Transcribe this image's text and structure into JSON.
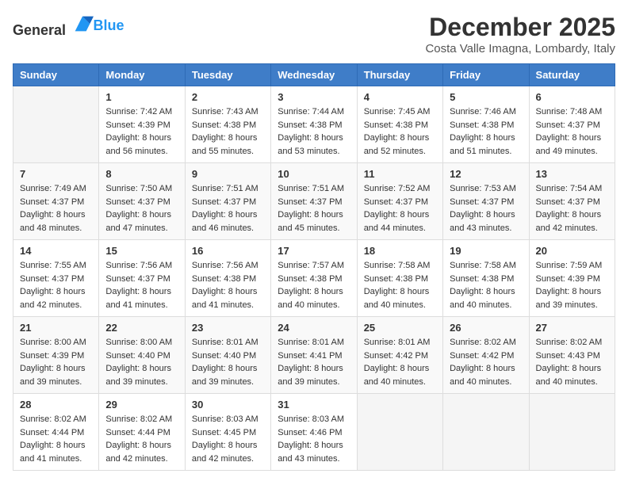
{
  "header": {
    "logo_general": "General",
    "logo_blue": "Blue",
    "month": "December 2025",
    "location": "Costa Valle Imagna, Lombardy, Italy"
  },
  "weekdays": [
    "Sunday",
    "Monday",
    "Tuesday",
    "Wednesday",
    "Thursday",
    "Friday",
    "Saturday"
  ],
  "weeks": [
    [
      {
        "day": "",
        "sunrise": "",
        "sunset": "",
        "daylight": ""
      },
      {
        "day": "1",
        "sunrise": "Sunrise: 7:42 AM",
        "sunset": "Sunset: 4:39 PM",
        "daylight": "Daylight: 8 hours and 56 minutes."
      },
      {
        "day": "2",
        "sunrise": "Sunrise: 7:43 AM",
        "sunset": "Sunset: 4:38 PM",
        "daylight": "Daylight: 8 hours and 55 minutes."
      },
      {
        "day": "3",
        "sunrise": "Sunrise: 7:44 AM",
        "sunset": "Sunset: 4:38 PM",
        "daylight": "Daylight: 8 hours and 53 minutes."
      },
      {
        "day": "4",
        "sunrise": "Sunrise: 7:45 AM",
        "sunset": "Sunset: 4:38 PM",
        "daylight": "Daylight: 8 hours and 52 minutes."
      },
      {
        "day": "5",
        "sunrise": "Sunrise: 7:46 AM",
        "sunset": "Sunset: 4:38 PM",
        "daylight": "Daylight: 8 hours and 51 minutes."
      },
      {
        "day": "6",
        "sunrise": "Sunrise: 7:48 AM",
        "sunset": "Sunset: 4:37 PM",
        "daylight": "Daylight: 8 hours and 49 minutes."
      }
    ],
    [
      {
        "day": "7",
        "sunrise": "Sunrise: 7:49 AM",
        "sunset": "Sunset: 4:37 PM",
        "daylight": "Daylight: 8 hours and 48 minutes."
      },
      {
        "day": "8",
        "sunrise": "Sunrise: 7:50 AM",
        "sunset": "Sunset: 4:37 PM",
        "daylight": "Daylight: 8 hours and 47 minutes."
      },
      {
        "day": "9",
        "sunrise": "Sunrise: 7:51 AM",
        "sunset": "Sunset: 4:37 PM",
        "daylight": "Daylight: 8 hours and 46 minutes."
      },
      {
        "day": "10",
        "sunrise": "Sunrise: 7:51 AM",
        "sunset": "Sunset: 4:37 PM",
        "daylight": "Daylight: 8 hours and 45 minutes."
      },
      {
        "day": "11",
        "sunrise": "Sunrise: 7:52 AM",
        "sunset": "Sunset: 4:37 PM",
        "daylight": "Daylight: 8 hours and 44 minutes."
      },
      {
        "day": "12",
        "sunrise": "Sunrise: 7:53 AM",
        "sunset": "Sunset: 4:37 PM",
        "daylight": "Daylight: 8 hours and 43 minutes."
      },
      {
        "day": "13",
        "sunrise": "Sunrise: 7:54 AM",
        "sunset": "Sunset: 4:37 PM",
        "daylight": "Daylight: 8 hours and 42 minutes."
      }
    ],
    [
      {
        "day": "14",
        "sunrise": "Sunrise: 7:55 AM",
        "sunset": "Sunset: 4:37 PM",
        "daylight": "Daylight: 8 hours and 42 minutes."
      },
      {
        "day": "15",
        "sunrise": "Sunrise: 7:56 AM",
        "sunset": "Sunset: 4:37 PM",
        "daylight": "Daylight: 8 hours and 41 minutes."
      },
      {
        "day": "16",
        "sunrise": "Sunrise: 7:56 AM",
        "sunset": "Sunset: 4:38 PM",
        "daylight": "Daylight: 8 hours and 41 minutes."
      },
      {
        "day": "17",
        "sunrise": "Sunrise: 7:57 AM",
        "sunset": "Sunset: 4:38 PM",
        "daylight": "Daylight: 8 hours and 40 minutes."
      },
      {
        "day": "18",
        "sunrise": "Sunrise: 7:58 AM",
        "sunset": "Sunset: 4:38 PM",
        "daylight": "Daylight: 8 hours and 40 minutes."
      },
      {
        "day": "19",
        "sunrise": "Sunrise: 7:58 AM",
        "sunset": "Sunset: 4:38 PM",
        "daylight": "Daylight: 8 hours and 40 minutes."
      },
      {
        "day": "20",
        "sunrise": "Sunrise: 7:59 AM",
        "sunset": "Sunset: 4:39 PM",
        "daylight": "Daylight: 8 hours and 39 minutes."
      }
    ],
    [
      {
        "day": "21",
        "sunrise": "Sunrise: 8:00 AM",
        "sunset": "Sunset: 4:39 PM",
        "daylight": "Daylight: 8 hours and 39 minutes."
      },
      {
        "day": "22",
        "sunrise": "Sunrise: 8:00 AM",
        "sunset": "Sunset: 4:40 PM",
        "daylight": "Daylight: 8 hours and 39 minutes."
      },
      {
        "day": "23",
        "sunrise": "Sunrise: 8:01 AM",
        "sunset": "Sunset: 4:40 PM",
        "daylight": "Daylight: 8 hours and 39 minutes."
      },
      {
        "day": "24",
        "sunrise": "Sunrise: 8:01 AM",
        "sunset": "Sunset: 4:41 PM",
        "daylight": "Daylight: 8 hours and 39 minutes."
      },
      {
        "day": "25",
        "sunrise": "Sunrise: 8:01 AM",
        "sunset": "Sunset: 4:42 PM",
        "daylight": "Daylight: 8 hours and 40 minutes."
      },
      {
        "day": "26",
        "sunrise": "Sunrise: 8:02 AM",
        "sunset": "Sunset: 4:42 PM",
        "daylight": "Daylight: 8 hours and 40 minutes."
      },
      {
        "day": "27",
        "sunrise": "Sunrise: 8:02 AM",
        "sunset": "Sunset: 4:43 PM",
        "daylight": "Daylight: 8 hours and 40 minutes."
      }
    ],
    [
      {
        "day": "28",
        "sunrise": "Sunrise: 8:02 AM",
        "sunset": "Sunset: 4:44 PM",
        "daylight": "Daylight: 8 hours and 41 minutes."
      },
      {
        "day": "29",
        "sunrise": "Sunrise: 8:02 AM",
        "sunset": "Sunset: 4:44 PM",
        "daylight": "Daylight: 8 hours and 42 minutes."
      },
      {
        "day": "30",
        "sunrise": "Sunrise: 8:03 AM",
        "sunset": "Sunset: 4:45 PM",
        "daylight": "Daylight: 8 hours and 42 minutes."
      },
      {
        "day": "31",
        "sunrise": "Sunrise: 8:03 AM",
        "sunset": "Sunset: 4:46 PM",
        "daylight": "Daylight: 8 hours and 43 minutes."
      },
      {
        "day": "",
        "sunrise": "",
        "sunset": "",
        "daylight": ""
      },
      {
        "day": "",
        "sunrise": "",
        "sunset": "",
        "daylight": ""
      },
      {
        "day": "",
        "sunrise": "",
        "sunset": "",
        "daylight": ""
      }
    ]
  ]
}
